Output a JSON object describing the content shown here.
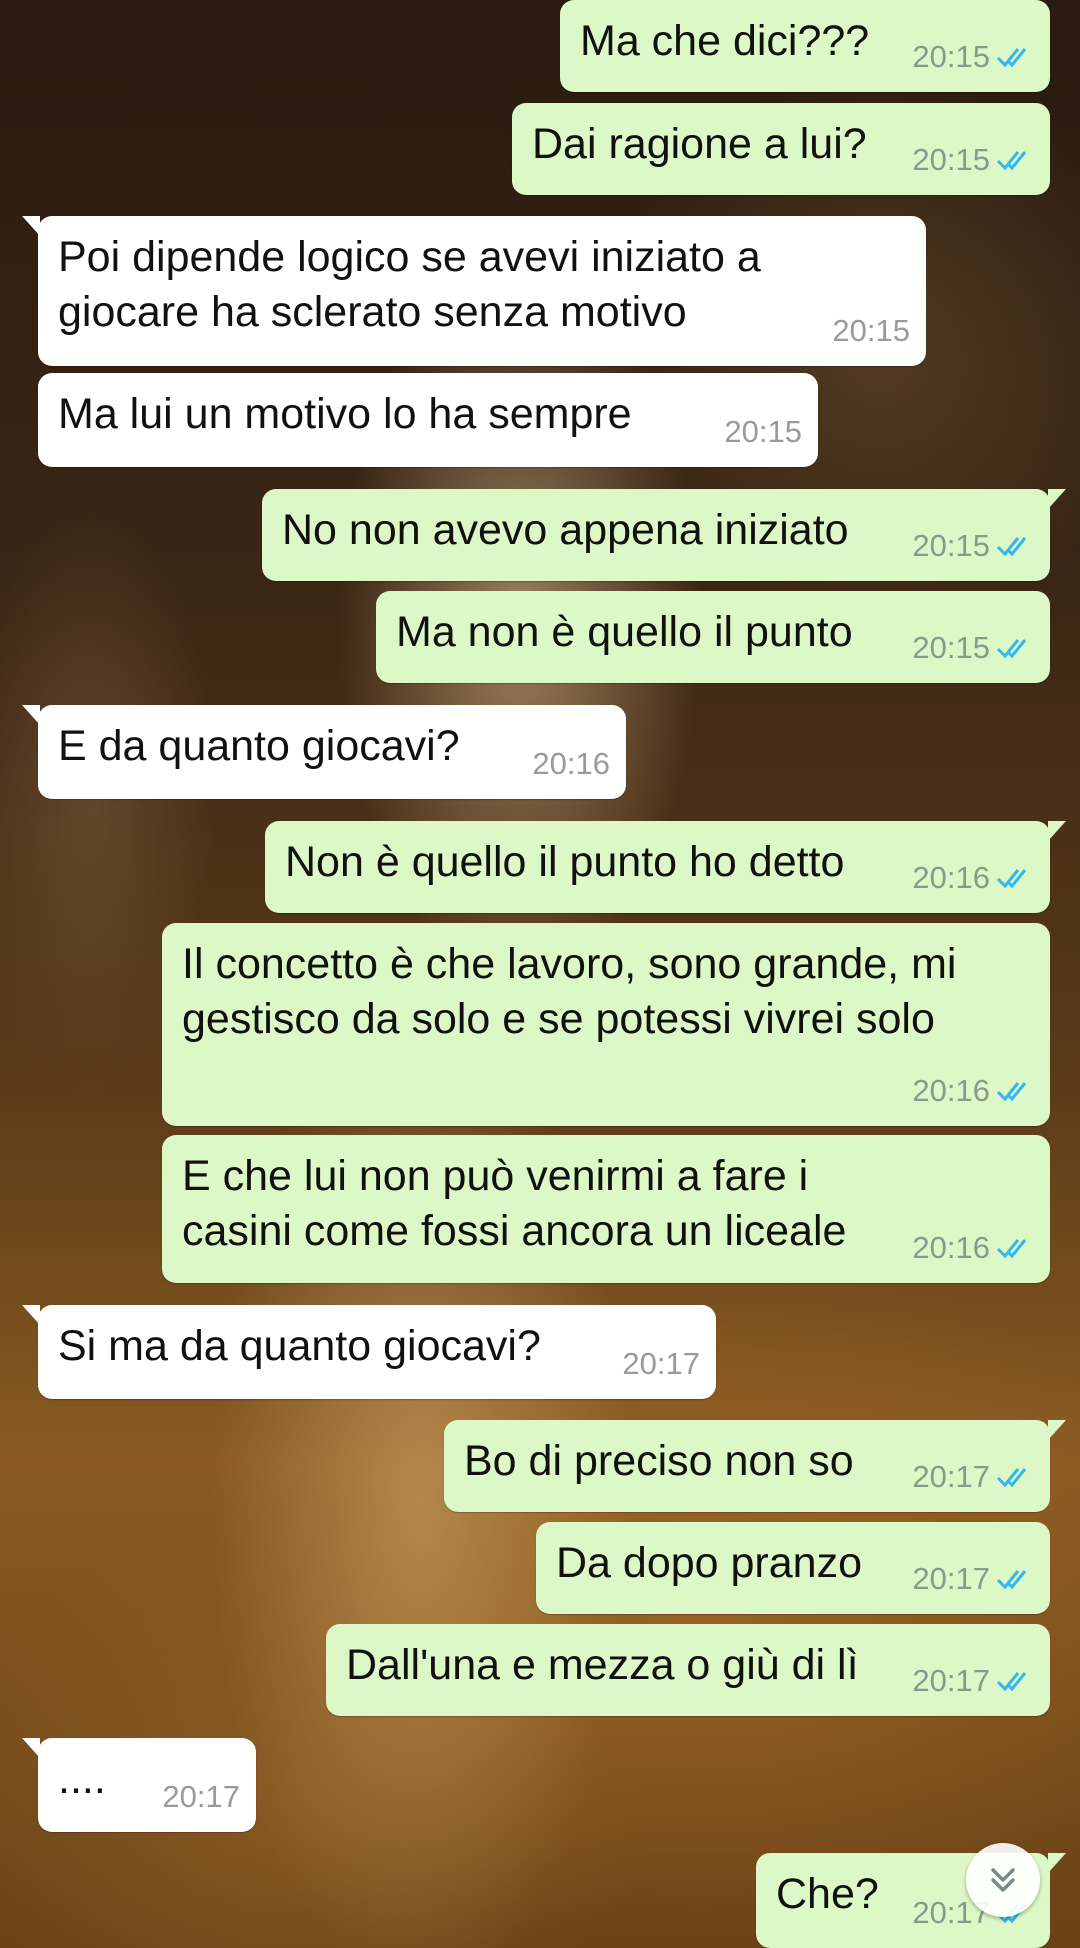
{
  "messages": [
    {
      "text": "Ma che dici???",
      "time": "20:15",
      "direction": "out"
    },
    {
      "text": "Dai ragione a lui?",
      "time": "20:15",
      "direction": "out"
    },
    {
      "text": "Poi dipende logico se avevi iniziato a giocare ha sclerato senza motivo",
      "time": "20:15",
      "direction": "in"
    },
    {
      "text": "Ma lui un motivo lo ha sempre",
      "time": "20:15",
      "direction": "in"
    },
    {
      "text": "No non avevo appena iniziato",
      "time": "20:15",
      "direction": "out"
    },
    {
      "text": "Ma non è quello il punto",
      "time": "20:15",
      "direction": "out"
    },
    {
      "text": "E da quanto giocavi?",
      "time": "20:16",
      "direction": "in"
    },
    {
      "text": "Non è quello il punto ho detto",
      "time": "20:16",
      "direction": "out"
    },
    {
      "text": "Il concetto è che lavoro, sono grande, mi gestisco da solo e se potessi vivrei solo",
      "time": "20:16",
      "direction": "out"
    },
    {
      "text": "E che lui non può venirmi a fare i casini come fossi ancora un liceale",
      "time": "20:16",
      "direction": "out"
    },
    {
      "text": "Si ma da quanto giocavi?",
      "time": "20:17",
      "direction": "in"
    },
    {
      "text": "Bo di preciso non so",
      "time": "20:17",
      "direction": "out"
    },
    {
      "text": "Da dopo pranzo",
      "time": "20:17",
      "direction": "out"
    },
    {
      "text": "Dall'una e mezza o giù di lì",
      "time": "20:17",
      "direction": "out"
    },
    {
      "text": "....",
      "time": "20:17",
      "direction": "in"
    },
    {
      "text": "Che?",
      "time": "20:17",
      "direction": "out"
    }
  ],
  "read_status": "double-check-read",
  "colors": {
    "outgoing_bubble": "#dcf8c6",
    "incoming_bubble": "#ffffff",
    "read_ticks": "#34b7f1"
  },
  "icons": {
    "read_receipt": "double-check-icon",
    "scroll_button": "chevrons-down-icon"
  }
}
